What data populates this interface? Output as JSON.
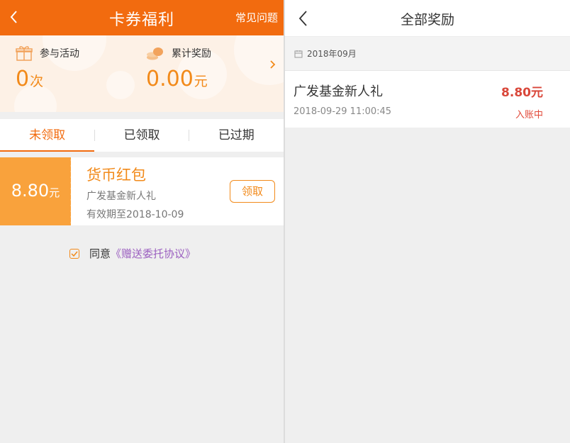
{
  "left": {
    "header": {
      "title": "卡券福利",
      "faq_label": "常见问题"
    },
    "stats": {
      "participate_label": "参与活动",
      "participate_value": "0",
      "participate_unit": "次",
      "reward_label": "累计奖励",
      "reward_value": "0.00",
      "reward_unit": "元"
    },
    "tabs": [
      {
        "label": "未领取",
        "active": true
      },
      {
        "label": "已领取",
        "active": false
      },
      {
        "label": "已过期",
        "active": false
      }
    ],
    "coupon": {
      "amount": "8.80",
      "unit": "元",
      "title": "货币红包",
      "subtitle": "广发基金新人礼",
      "expiry": "有效期至2018-10-09",
      "claim_label": "领取"
    },
    "agreement": {
      "text": "同意",
      "link": "《赠送委托协议》"
    }
  },
  "right": {
    "header": {
      "title": "全部奖励"
    },
    "month": "2018年09月",
    "records": [
      {
        "name": "广发基金新人礼",
        "time": "2018-09-29 11:00:45",
        "amount": "8.80元",
        "status": "入账中"
      }
    ]
  },
  "colors": {
    "brand_orange": "#f26b0f",
    "coupon_orange": "#f9a23c",
    "amount_red": "#d9473a",
    "link_purple": "#9b5fc0"
  },
  "icons": [
    "back-arrow-icon",
    "gift-icon",
    "coins-icon",
    "chevron-right-icon",
    "checkbox-icon",
    "calendar-icon"
  ]
}
